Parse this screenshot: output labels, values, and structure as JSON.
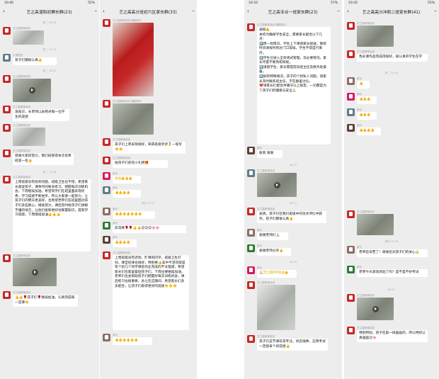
{
  "phones": [
    {
      "status": {
        "time": "10:40",
        "right": "55%"
      },
      "title": "艺之高湛阳初赛长群(23)",
      "messages": [
        {
          "type": "time",
          "text": "周二 09:03"
        },
        {
          "type": "image",
          "sender": "艺之高教育培训"
        },
        {
          "type": "time",
          "text": "周二 15:41"
        },
        {
          "type": "text",
          "sender": "沙漠里的",
          "text": "孩子们都很认真👍"
        },
        {
          "type": "time",
          "text": "周二 16:42"
        },
        {
          "type": "video",
          "sender": "艺之高教育培训"
        },
        {
          "type": "text",
          "sender": "艺之高教育培训",
          "text": "涨知识，长老师以表扬点每一位学生的成绩"
        },
        {
          "type": "image",
          "sender": "艺之高教育培训"
        },
        {
          "type": "text",
          "sender": "艺之高教育培训",
          "text": "感谢大家的努力，我们班获得本次优秀班第一名👍"
        },
        {
          "type": "time",
          "text": "周二 17:36"
        },
        {
          "type": "text",
          "sender": "艺之高教育培训",
          "text": "上周班级没有找到问题，班级卫生也不错，希望家长督促孩子，课余时间要多练习，把握每次训练机会，下周继续加油，希望同学们在班里面表现优秀，学习成绩不断进步，所以大家要一起努力，让孩子们的明天更美好，也希望老师们在班里面对孩子们多些耐心，继续努力，课后及时给孩子们讲解不懂的地方，让他们能够更好地掌握知识，提高学习成绩，下周继续加油👍👍👍"
        },
        {
          "type": "video",
          "sender": "艺之高教育培训"
        },
        {
          "type": "text",
          "sender": "艺之高教育培训",
          "text": "👍👍🌹孩子们🌹继续加油，认真完成每一堂课👏"
        }
      ]
    },
    {
      "status": {
        "time": "",
        "right": ""
      },
      "title": "艺之高高分班初六区家长群(33)",
      "messages": [
        {
          "type": "image-red",
          "sender": "艺之高教育培训·课程顾问"
        },
        {
          "type": "image",
          "sender": "艺之高教育培训·课程顾问"
        },
        {
          "type": "text",
          "sender": "艺之高教育培训",
          "text": "孩子们上周表现很好，荣获班级奖状🏅一等奖👏👏"
        },
        {
          "type": "text",
          "sender": "艺之高教育培训",
          "text": "给孩子们买的小礼物🎁"
        },
        {
          "type": "flowers",
          "sender": "家长",
          "text": "加油👍👍👍"
        },
        {
          "type": "flowers",
          "sender": "家长",
          "text": "👍👍👍👍"
        },
        {
          "type": "time",
          "text": "周五 15:57"
        },
        {
          "type": "flowers",
          "sender": "家长",
          "text": "👍👍👍👍👍👍👍"
        },
        {
          "type": "text",
          "sender": "家长",
          "text": "非常棒🌹🌹👍👍😊😊😊🌸🌸"
        },
        {
          "type": "flowers",
          "sender": "家长",
          "text": "👍👍👍👍"
        },
        {
          "type": "text",
          "sender": "艺之高教育培训",
          "text": "上周班级没有迟到、旷课的同学，班级卫生打扫，课堂纪律也很好，特别棒👍美中不足的就是有个别几个同学课后作业完成的不太理想，希望家长们在家里督促孩子们，下周也要继续加油，老师们也会帮助孩子们把握好每次训练机会，课后练习也很重要，总之在这期间，希望家长们多多配合，让孩子们取得更好的成绩👏👏👏"
        },
        {
          "type": "flowers",
          "sender": "家长",
          "text": "👍👍👍👍👍👍"
        }
      ]
    },
    {
      "status": {
        "time": "10:33",
        "right": "57%"
      },
      "title": "艺之高专业一班家长群(23)",
      "messages": [
        {
          "type": "text",
          "sender": "艺之高教育培训·课程顾问",
          "text": "通知⚠️\n本校为确保学生安全，需要家长配合以下几点：\n1️⃣周一到周日，学生上下课请家长接送，离校时间请按时到达门口等候，学生不得自行离开。\n2️⃣学生已进入全封闭式管理，非必要情况，家长尽量不要到校探视。\n3️⃣请假学生，家长需提前向班主任及教务处报备。\n4️⃣如有特殊情况，孩子的个别私人问题，请家长及时联系班主任，不在群里讨论。\n❤️请家长们配合并遵守以上规定，一切都是为了孩子们的健康与安全🙏"
        },
        {
          "type": "text",
          "sender": "家长",
          "text": "收到 谢谢"
        },
        {
          "type": "time",
          "text": "08:15"
        },
        {
          "type": "video",
          "sender": "艺之高教育培训"
        },
        {
          "type": "time",
          "text": "09:11"
        },
        {
          "type": "text",
          "sender": "艺之高教育培训",
          "text": "表扬，孩子们在我们班级中的优点评比中获奖，孩子们都很认真👍"
        },
        {
          "type": "text",
          "sender": "家长",
          "text": "谢谢老师们🙏"
        },
        {
          "type": "text",
          "sender": "家长",
          "text": "谢谢老师分享👍"
        },
        {
          "type": "time",
          "text": "09:29"
        },
        {
          "type": "flowers",
          "sender": "家长",
          "text": "🙏艺之高同学加油👍"
        },
        {
          "type": "image",
          "sender": "艺之高教育培训"
        },
        {
          "type": "text",
          "sender": "艺之高教育培训",
          "text": "孩子们这节课非常专注，状态很棒，这周考试一定能拿个好成绩👍"
        }
      ]
    },
    {
      "status": {
        "time": "10:42",
        "right": "55%"
      },
      "title": "艺之高高分冲刺二班家长群(41)",
      "messages": [
        {
          "type": "image",
          "sender": "艺之高教育培训"
        },
        {
          "type": "text",
          "sender": "艺之高教育培训",
          "text": "色彩课作品完成得很好，很认真的学生在学"
        },
        {
          "type": "time",
          "text": "周二 21:45"
        },
        {
          "type": "flowers",
          "sender": "家长",
          "text": "👍"
        },
        {
          "type": "flowers",
          "sender": "家长",
          "text": "👍👍👍"
        },
        {
          "type": "flowers",
          "sender": "家长",
          "text": "👍👍👍"
        },
        {
          "type": "flowers",
          "sender": "家长",
          "text": "👍👍👍👍"
        },
        {
          "type": "image",
          "sender": "艺之高教育培训"
        },
        {
          "type": "time",
          "text": "周四 15:38"
        },
        {
          "type": "text",
          "sender": "家长",
          "text": "老师您辛苦了！谢谢您对孩子们的关心🙏"
        },
        {
          "type": "text",
          "sender": "家长",
          "text": "老师今天滚动测验了吗？是不是不好考试"
        },
        {
          "type": "time",
          "text": "08:31"
        },
        {
          "type": "video",
          "sender": "艺之高教育培训"
        },
        {
          "type": "text",
          "sender": "艺之高教育培训",
          "text": "特别特别，孩子在第一排画画的，所以特别认真画画😊🌸"
        }
      ]
    }
  ]
}
